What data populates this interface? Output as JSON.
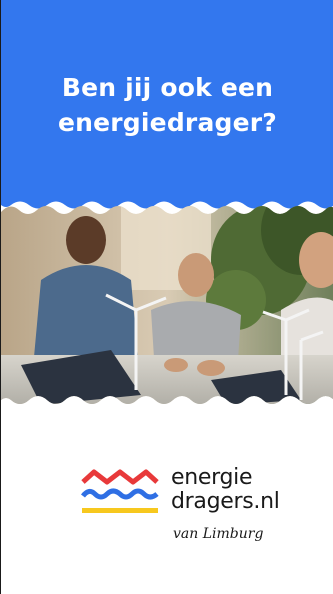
{
  "banner": {
    "headline_line1": "Ben jij ook een",
    "headline_line2": "energiedrager?",
    "background_color": "#3377ee",
    "photo_description_icon": "team-solar-model-photo"
  },
  "logo": {
    "line1": "energie",
    "line2": "dragers.nl",
    "subtitle": "van Limburg",
    "colors": {
      "red": "#e8393a",
      "blue": "#2f6fe4",
      "yellow": "#f7c81e"
    }
  }
}
